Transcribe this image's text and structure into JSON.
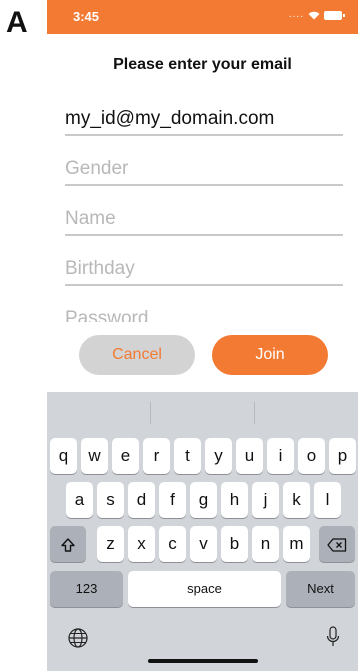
{
  "panel_label": "A",
  "status_bar": {
    "time": "3:45",
    "signal": "....",
    "color": "#f37a32"
  },
  "form": {
    "title": "Please enter your email",
    "email_value": "my_id@my_domain.com",
    "gender_placeholder": "Gender",
    "name_placeholder": "Name",
    "birthday_placeholder": "Birthday",
    "password_placeholder": "Password"
  },
  "buttons": {
    "cancel": "Cancel",
    "join": "Join"
  },
  "keyboard": {
    "row1": [
      "q",
      "w",
      "e",
      "r",
      "t",
      "y",
      "u",
      "i",
      "o",
      "p"
    ],
    "row2": [
      "a",
      "s",
      "d",
      "f",
      "g",
      "h",
      "j",
      "k",
      "l"
    ],
    "row3": [
      "z",
      "x",
      "c",
      "v",
      "b",
      "n",
      "m"
    ],
    "numbers_key": "123",
    "space_key": "space",
    "next_key": "Next"
  },
  "icons": [
    "shift-icon",
    "backspace-icon",
    "globe-icon",
    "mic-icon",
    "wifi-icon",
    "battery-icon"
  ]
}
